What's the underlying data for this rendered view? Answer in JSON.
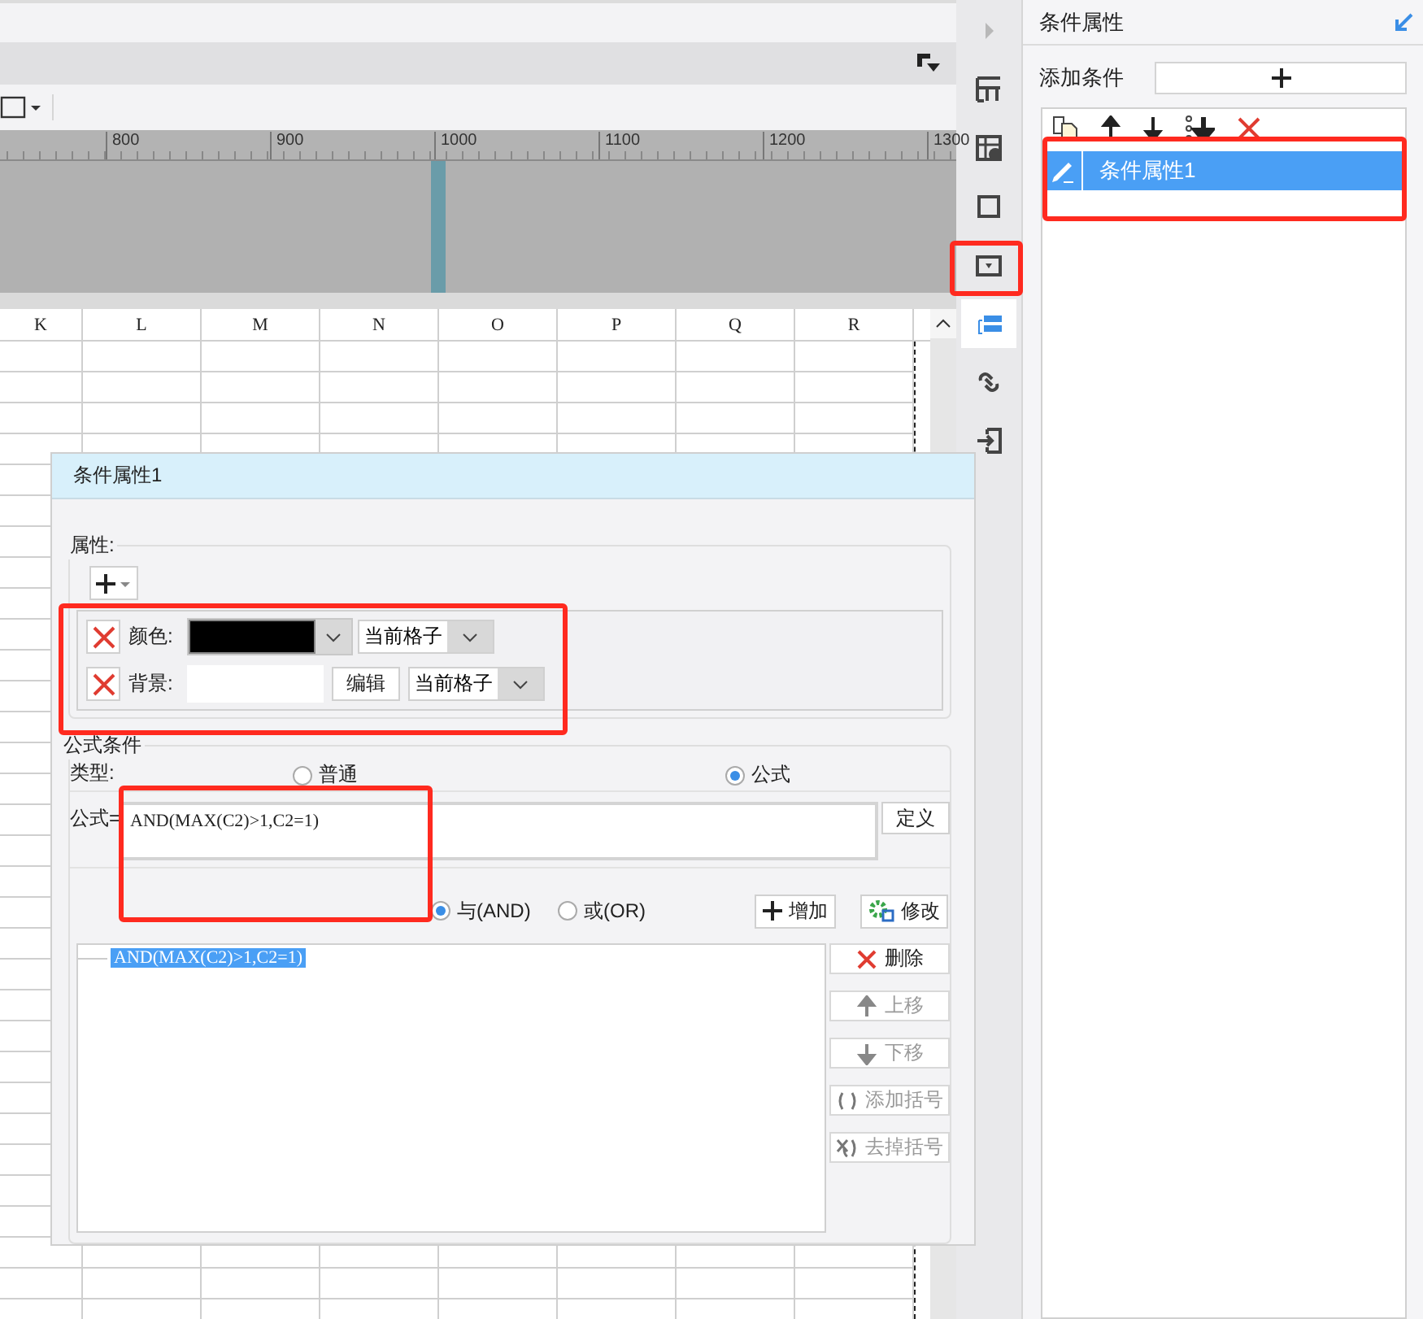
{
  "top_bar": {
    "ruler_ticks": [
      "800",
      "900",
      "1000",
      "1100",
      "1200",
      "1300"
    ]
  },
  "grid": {
    "columns": [
      "K",
      "L",
      "M",
      "N",
      "O",
      "P",
      "Q",
      "R"
    ]
  },
  "tool_strip": [
    {
      "kind": "expand",
      "selected": false
    },
    {
      "kind": "layout",
      "selected": false
    },
    {
      "kind": "cell-info",
      "selected": false
    },
    {
      "kind": "frame",
      "selected": false
    },
    {
      "kind": "dropdown",
      "selected": false
    },
    {
      "kind": "condition",
      "selected": true
    },
    {
      "kind": "link",
      "selected": false
    },
    {
      "kind": "import",
      "selected": false
    }
  ],
  "dialog": {
    "title": "条件属性1",
    "properties": {
      "label": "属性:",
      "rows": [
        {
          "kind": "color",
          "label": "颜色:",
          "scope": "当前格子"
        },
        {
          "kind": "background",
          "label": "背景:",
          "button": "编辑",
          "scope": "当前格子"
        }
      ]
    },
    "formula_condition": {
      "label": "公式条件",
      "type_label": "类型:",
      "types": [
        {
          "label": "普通",
          "selected": false
        },
        {
          "label": "公式",
          "selected": true
        }
      ],
      "formula_label": "公式=",
      "formula": "AND(MAX(C2)>1,C2=1)",
      "define_button": "定义",
      "logic": [
        {
          "label": "与(AND)",
          "selected": true
        },
        {
          "label": "或(OR)",
          "selected": false
        }
      ],
      "add_button": "增加",
      "modify_button": "修改",
      "conditions": [
        {
          "text": "AND(MAX(C2)>1,C2=1)",
          "selected": true
        }
      ],
      "actions": [
        {
          "kind": "delete",
          "label": "删除",
          "disabled": false
        },
        {
          "kind": "up",
          "label": "上移",
          "disabled": true
        },
        {
          "kind": "down",
          "label": "下移",
          "disabled": true
        },
        {
          "kind": "add-brackets",
          "label": "添加括号",
          "disabled": true
        },
        {
          "kind": "remove-brackets",
          "label": "去掉括号",
          "disabled": true
        }
      ]
    }
  },
  "panel": {
    "title": "条件属性",
    "add_label": "添加条件",
    "items": [
      {
        "label": "条件属性1",
        "selected": true
      }
    ]
  }
}
